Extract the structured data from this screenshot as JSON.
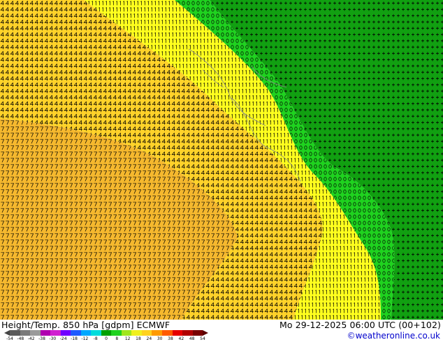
{
  "map": {
    "color_high": "#11a011",
    "color_mid": "#1fd21f",
    "color_low": "#ffff1e",
    "color_lower": "#ffd22a",
    "color_lowest": "#f5b82e",
    "land_line_color": "#888888",
    "regions": [
      {
        "name": "green-high",
        "digit": "+",
        "fill": "#11a011"
      },
      {
        "name": "green-mid",
        "digit": "0",
        "fill": "#1fd21f"
      },
      {
        "name": "yellow",
        "digit": "1",
        "fill": "#ffff1e"
      },
      {
        "name": "yellow-orange",
        "digit": "4",
        "fill": "#ffd22a"
      },
      {
        "name": "orange",
        "digit": "7",
        "fill": "#f5b82e"
      }
    ]
  },
  "footer": {
    "left_text": "Height/Temp. 850 hPa [gdpm] ECMWF",
    "right_text": "Mo 29-12-2025 06:00 UTC (00+102)",
    "credit": "©weatheronline.co.uk"
  },
  "colorbar": {
    "ticks": [
      "-54",
      "-48",
      "-42",
      "-38",
      "-30",
      "-24",
      "-18",
      "-12",
      "-8",
      "0",
      "8",
      "12",
      "18",
      "24",
      "30",
      "38",
      "42",
      "48",
      "54"
    ],
    "colors": [
      "#5a5a5a",
      "#7a7a7a",
      "#9a9a9a",
      "#b000b0",
      "#d020d0",
      "#7000ff",
      "#1f5aff",
      "#00a8ff",
      "#00dcdc",
      "#00a000",
      "#1fd21f",
      "#a0e61e",
      "#f0f01e",
      "#ffd21e",
      "#ff9a00",
      "#ff5a00",
      "#e60000",
      "#b00000",
      "#780000"
    ],
    "tip_left_color": "#444444",
    "tip_right_color": "#5a0000"
  }
}
